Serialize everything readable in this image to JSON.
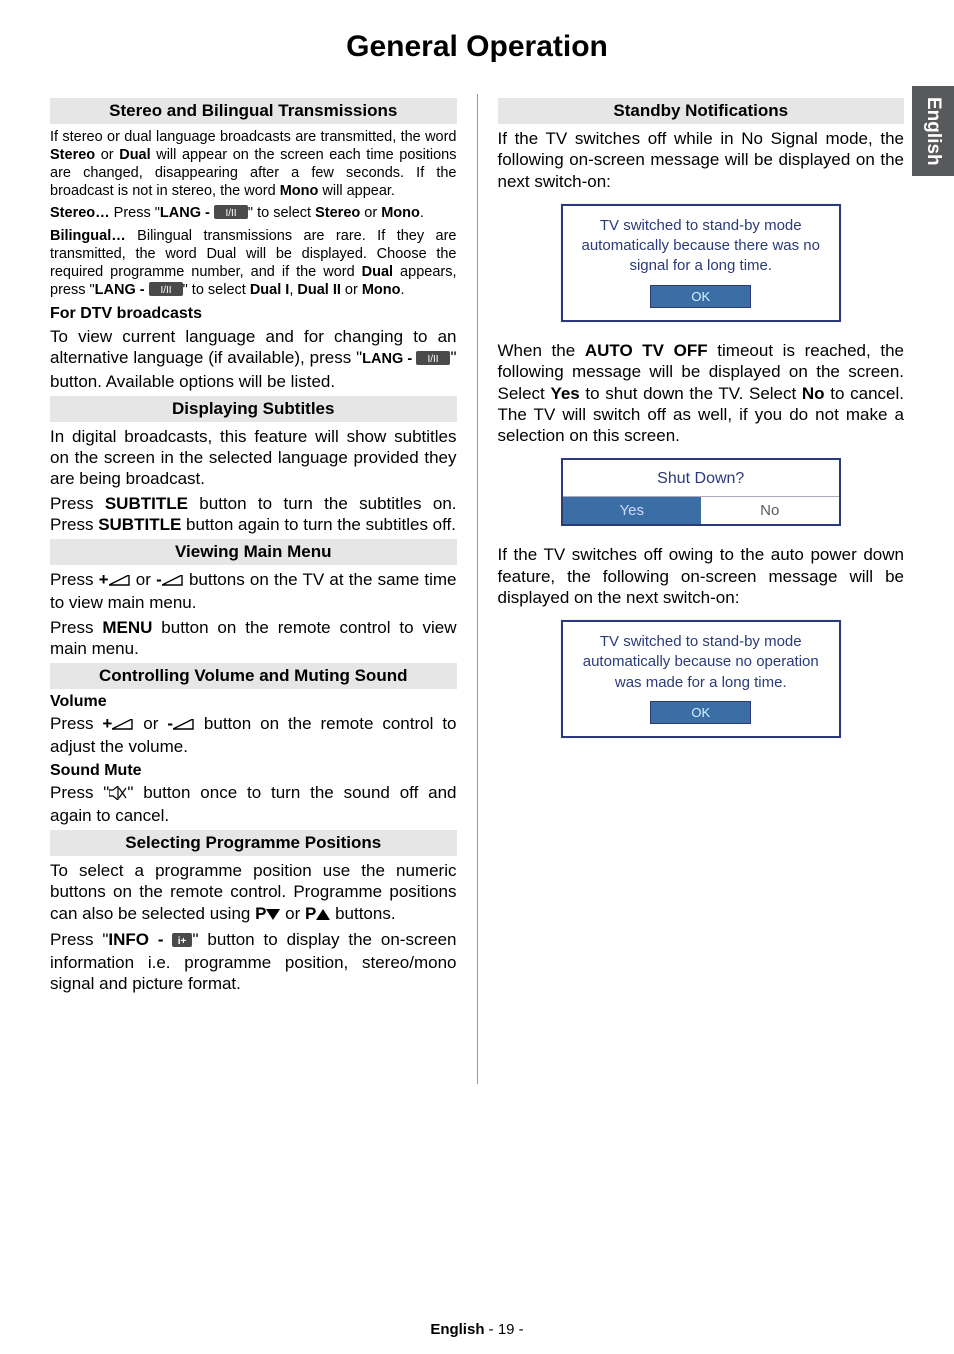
{
  "title": "General Operation",
  "side_tab": "English",
  "left": {
    "s1": {
      "heading": "Stereo and Bilingual Transmissions",
      "p1a": "If stereo or dual language broadcasts are transmitted, the word ",
      "p1b": "Stereo",
      "p1c": " or ",
      "p1d": "Dual",
      "p1e": " will appear on the screen each time positions are changed, disappearing after a few seconds. If the broadcast is not in stereo, the word ",
      "p1f": "Mono",
      "p1g": " will appear.",
      "p2a": "Stereo…",
      "p2b": " Press \"",
      "p2c": "LANG - ",
      "p2d": "\" to select ",
      "p2e": "Stereo",
      "p2f": " or ",
      "p2g": "Mono",
      "p2h": ".",
      "p3a": "Bilingual…",
      "p3b": " Bilingual transmissions are rare. If they are transmitted, the word Dual will be displayed. Choose the required programme number, and if the word ",
      "p3c": "Dual",
      "p3d": " appears, press \"",
      "p3e": "LANG - ",
      "p3f": "\" to select ",
      "p3g": "Dual I",
      "p3h": ", ",
      "p3i": "Dual II",
      "p3j": " or ",
      "p3k": "Mono",
      "p3l": ".",
      "sub1": "For DTV broadcasts",
      "p4a": "To view current language and for changing to an alternative language (if available), press \"",
      "p4b": "LANG - ",
      "p4c": "\" button. Available options will be listed."
    },
    "s2": {
      "heading": "Displaying Subtitles",
      "p1": "In digital broadcasts, this feature will show subtitles on the screen in the selected language provided they are being broadcast.",
      "p2a": "Press ",
      "p2b": "SUBTITLE",
      "p2c": " button to turn the subtitles on. Press ",
      "p2d": "SUBTITLE",
      "p2e": " button again to turn the subtitles off."
    },
    "s3": {
      "heading": "Viewing Main Menu",
      "p1a": "Press ",
      "p1b": "+",
      "p1c": " or ",
      "p1d": "-",
      "p1e": " buttons on the TV at the same time to view main menu.",
      "p2a": "Press ",
      "p2b": "MENU",
      "p2c": " button on the remote control to view main menu."
    },
    "s4": {
      "heading": "Controlling Volume and Muting Sound",
      "sub1": "Volume",
      "p1a": "Press ",
      "p1b": "+",
      "p1c": " or ",
      "p1d": "-",
      "p1e": " button on the remote control to adjust the volume.",
      "sub2": "Sound Mute",
      "p2a": "Press \"",
      "p2b": "\" button once to turn the sound off and again to cancel."
    },
    "s5": {
      "heading": "Selecting Programme Positions",
      "p1a": "To select a programme position use the numeric buttons on the remote control. Programme positions can also be selected using ",
      "p1b": "P",
      "p1c": " or ",
      "p1d": "P",
      "p1e": " buttons.",
      "p2a": "Press \"",
      "p2b": "INFO - ",
      "p2c": "\" button to display the on-screen information i.e. programme position, stereo/mono signal and picture format."
    }
  },
  "right": {
    "s1": {
      "heading": "Standby Notifications",
      "p1": "If the TV switches off while in No Signal mode, the following on-screen message will be displayed on the next switch-on:",
      "dialog1_msg": "TV switched to stand-by mode automatically because there was no signal for a long time.",
      "dialog1_ok": "OK",
      "p2a": "When the ",
      "p2b": "AUTO TV OFF",
      "p2c": " timeout is reached, the following message will be displayed on the screen. Select ",
      "p2d": "Yes",
      "p2e": " to shut down the TV. Select ",
      "p2f": "No",
      "p2g": " to cancel. The TV will switch off as well, if you do not make a selection on this screen.",
      "dialog2_q": "Shut Down?",
      "dialog2_yes": "Yes",
      "dialog2_no": "No",
      "p3": "If the TV switches off owing to the auto power down feature, the following on-screen message will be displayed on the next switch-on:",
      "dialog3_msg": "TV switched to stand-by mode automatically because no operation was made for a long time.",
      "dialog3_ok": "OK"
    }
  },
  "footer": {
    "lang": "English",
    "sep": "   - ",
    "page": "19",
    "end": " -"
  }
}
